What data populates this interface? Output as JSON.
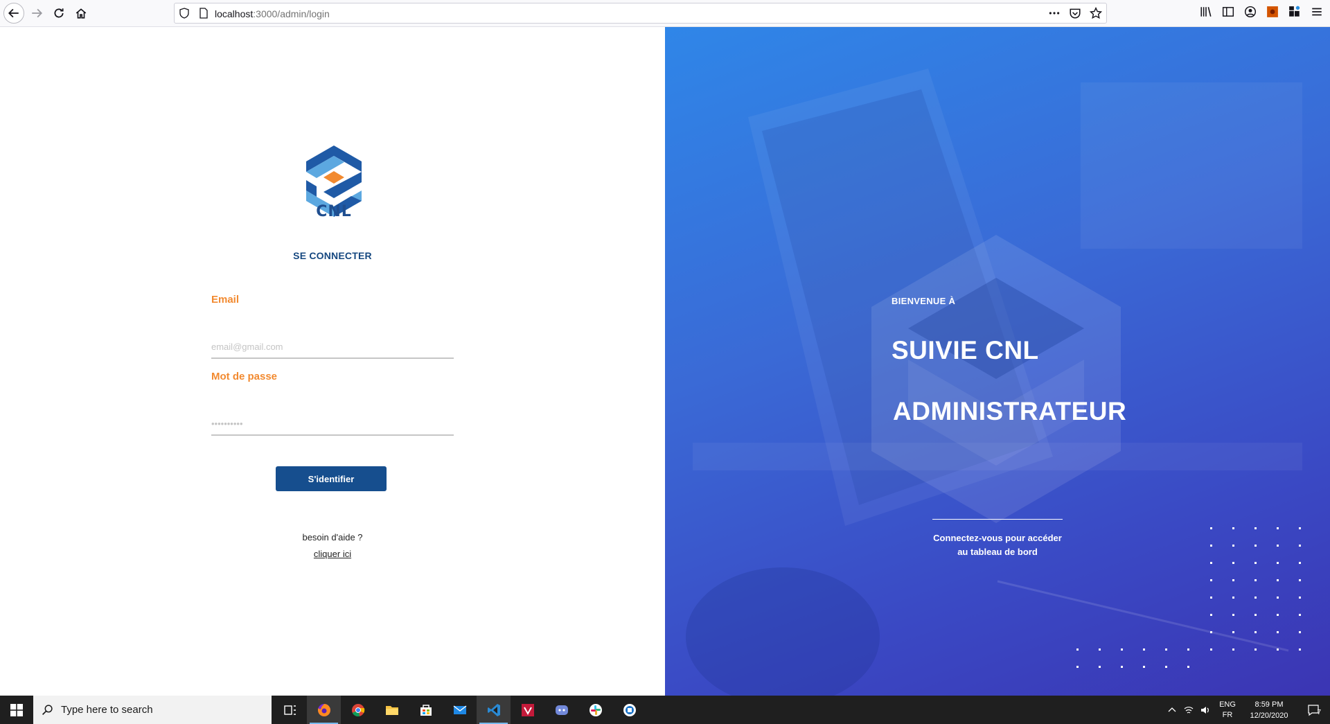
{
  "browser": {
    "url_host": "localhost",
    "url_path": ":3000/admin/login"
  },
  "login": {
    "brand": "CNL",
    "title": "SE CONNECTER",
    "email_label": "Email",
    "email_placeholder": "email@gmail.com",
    "password_label": "Mot de passe",
    "password_placeholder": "••••••••••",
    "submit_label": "S'identifier",
    "help_text": "besoin d'aide ?",
    "help_link": "cliquer ici"
  },
  "hero": {
    "welcome": "BIENVENUE À",
    "title": "SUIVIE CNL",
    "subtitle": "ADMINISTRATEUR",
    "tagline_line1": "Connectez-vous pour accéder",
    "tagline_line2": "au tableau de bord"
  },
  "taskbar": {
    "search_placeholder": "Type here to search",
    "language_line1": "ENG",
    "language_line2": "FR",
    "time": "8:59 PM",
    "date": "12/20/2020",
    "notification_count": "7",
    "apps": [
      "task-view",
      "firefox",
      "chrome",
      "file-explorer",
      "store",
      "mail",
      "vscode",
      "vivaldi",
      "discord",
      "slack",
      "app"
    ]
  },
  "colors": {
    "brand_blue": "#164e8e",
    "accent_orange": "#f28a30",
    "hero_gradient_start": "#2f86e8",
    "hero_gradient_end": "#3b35b3"
  }
}
